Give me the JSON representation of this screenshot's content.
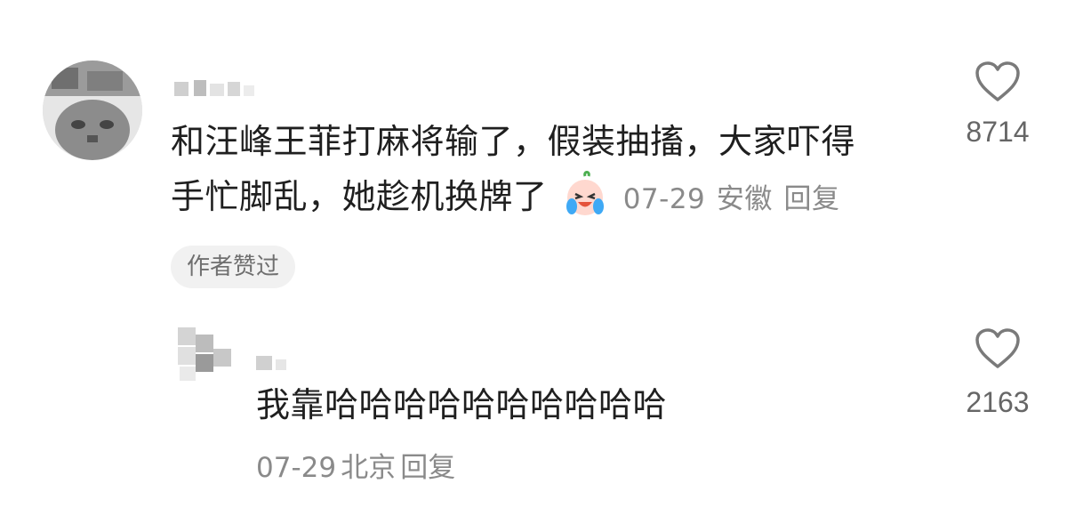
{
  "comments": [
    {
      "username": "",
      "text_line1": "和汪峰王菲打麻将输了，假装抽搐，大家吓得",
      "text_line2": "手忙脚乱，她趁机换牌了",
      "emoji": "laugh-cry-emoji",
      "date": "07-29",
      "location": "安徽",
      "reply_label": "回复",
      "badge": "作者赞过",
      "likes": "8714"
    },
    {
      "username": "",
      "text": "我靠哈哈哈哈哈哈哈哈哈哈",
      "date": "07-29",
      "location": "北京",
      "reply_label": "回复",
      "likes": "2163"
    }
  ],
  "colors": {
    "text": "#1f1f1f",
    "meta": "#8a8a8a",
    "badge_bg": "#f1f1f1",
    "heart_stroke": "#7a7a7a"
  }
}
